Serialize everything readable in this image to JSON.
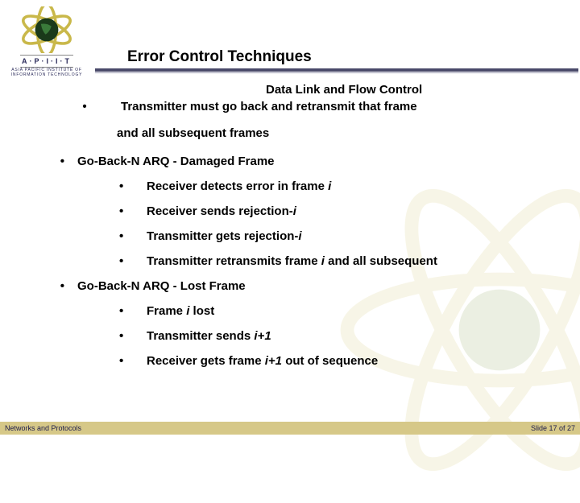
{
  "logo": {
    "acronym": "A·P·I·I·T",
    "subtext": "ASIA PACIFIC INSTITUTE OF\nINFORMATION TECHNOLOGY"
  },
  "slide": {
    "title": "Error Control Techniques",
    "subject": "Data Link and Flow Control"
  },
  "content": {
    "cont_line1": "Transmitter must go back and retransmit that frame",
    "cont_line2": "and all subsequent frames",
    "section1": {
      "header": "Go-Back-N  ARQ - Damaged Frame",
      "items": [
        {
          "pre": "Receiver detects error in frame ",
          "it": "i",
          "post": ""
        },
        {
          "pre": "Receiver sends rejection-",
          "it": "i",
          "post": ""
        },
        {
          "pre": "Transmitter gets rejection-",
          "it": "i",
          "post": ""
        },
        {
          "pre": "Transmitter retransmits frame ",
          "it": "i",
          "post": " and all subsequent"
        }
      ]
    },
    "section2": {
      "header": "Go-Back-N  ARQ - Lost Frame",
      "items": [
        {
          "pre": "Frame ",
          "it": "i ",
          "post": " lost"
        },
        {
          "pre": "Transmitter sends ",
          "it": "i+1",
          "post": ""
        },
        {
          "pre": "Receiver gets frame ",
          "it": "i+1",
          "post": " out of sequence"
        }
      ]
    }
  },
  "footer": {
    "left": "Networks and Protocols",
    "right_prefix": "Slide ",
    "page": "17",
    "of": " of ",
    "total": "27"
  }
}
